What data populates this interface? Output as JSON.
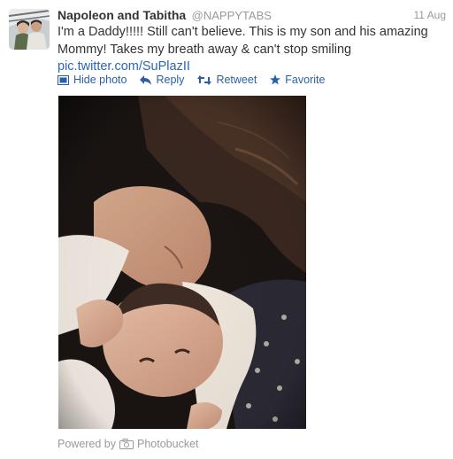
{
  "tweet": {
    "author_name": "Napoleon and Tabitha",
    "author_handle": "@NAPPYTABS",
    "date": "11 Aug",
    "text": "I'm a Daddy!!!!! Still can't believe. This is my son and his amazing Mommy! Takes my breath away & can't stop smiling",
    "link": "pic.twitter.com/SuPlazII"
  },
  "actions": {
    "hide_photo": "Hide photo",
    "reply": "Reply",
    "retweet": "Retweet",
    "favorite": "Favorite"
  },
  "footer": {
    "powered_by": "Powered by",
    "provider": "Photobucket"
  },
  "icons": {
    "photo": "photo-icon",
    "reply": "reply-arrow-icon",
    "retweet": "retweet-icon",
    "favorite": "star-icon",
    "camera": "camera-icon"
  },
  "colors": {
    "link": "#2a66b3",
    "action": "#2a5fa8",
    "muted": "#999999",
    "text": "#333333"
  }
}
